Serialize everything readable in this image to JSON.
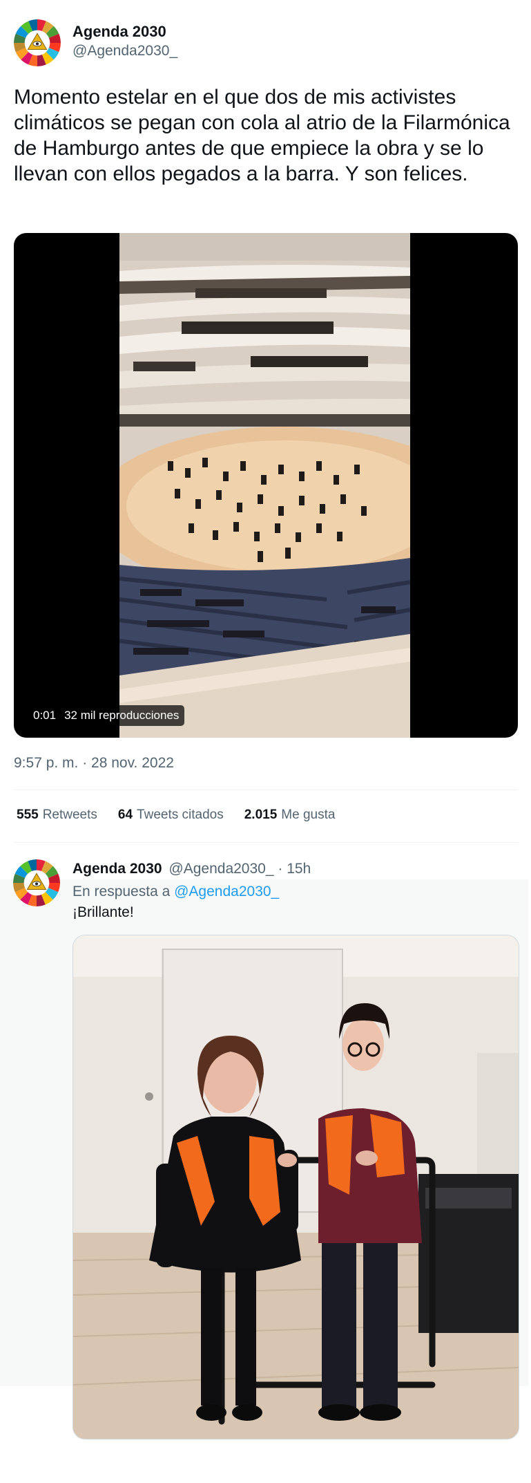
{
  "tweet": {
    "author_name": "Agenda 2030",
    "author_handle": "@Agenda2030_",
    "text": "Momento estelar en el que dos de mis activistes climáticos se pegan con cola al atrio de la Filarmónica de Hamburgo antes de que empiece la obra y se lo llevan con ellos pegados a la barra. Y son felices.",
    "video": {
      "elapsed": "0:01",
      "views": "32 mil reproducciones"
    },
    "timestamp": "9:57 p. m. · 28 nov. 2022",
    "stats": {
      "retweets_count": "555",
      "retweets_label": "Retweets",
      "quotes_count": "64",
      "quotes_label": "Tweets citados",
      "likes_count": "2.015",
      "likes_label": "Me gusta"
    }
  },
  "reply": {
    "author_name": "Agenda 2030",
    "author_handle": "@Agenda2030_",
    "time": "· 15h",
    "context_prefix": "En respuesta a",
    "context_mention": "@Agenda2030_",
    "text": "¡Brillante!"
  },
  "colors": {
    "text_primary": "#0f1419",
    "text_secondary": "#536471",
    "link": "#1d9bf0",
    "divider": "#eff3f4",
    "reply_background": "#f7f9f9",
    "activist_vest": "#f26a1b"
  },
  "icons": {
    "avatar": "sdg-wheel-eye-icon"
  }
}
